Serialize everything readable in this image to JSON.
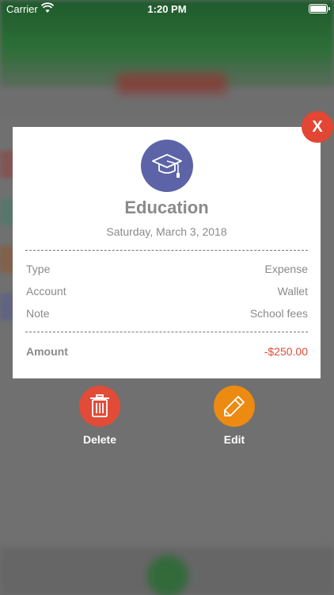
{
  "status_bar": {
    "carrier": "Carrier",
    "time": "1:20 PM"
  },
  "transaction": {
    "category": "Education",
    "category_icon": "graduation-cap-icon",
    "category_color": "#5c63a6",
    "date": "Saturday, March 3, 2018",
    "details": [
      {
        "label": "Type",
        "value": "Expense"
      },
      {
        "label": "Account",
        "value": "Wallet"
      },
      {
        "label": "Note",
        "value": "School fees"
      }
    ],
    "amount_label": "Amount",
    "amount_value": "-$250.00",
    "amount_color": "#e14b37"
  },
  "actions": {
    "close_label": "X",
    "delete_label": "Delete",
    "edit_label": "Edit",
    "delete_color": "#e14b37",
    "edit_color": "#ec8a12"
  }
}
